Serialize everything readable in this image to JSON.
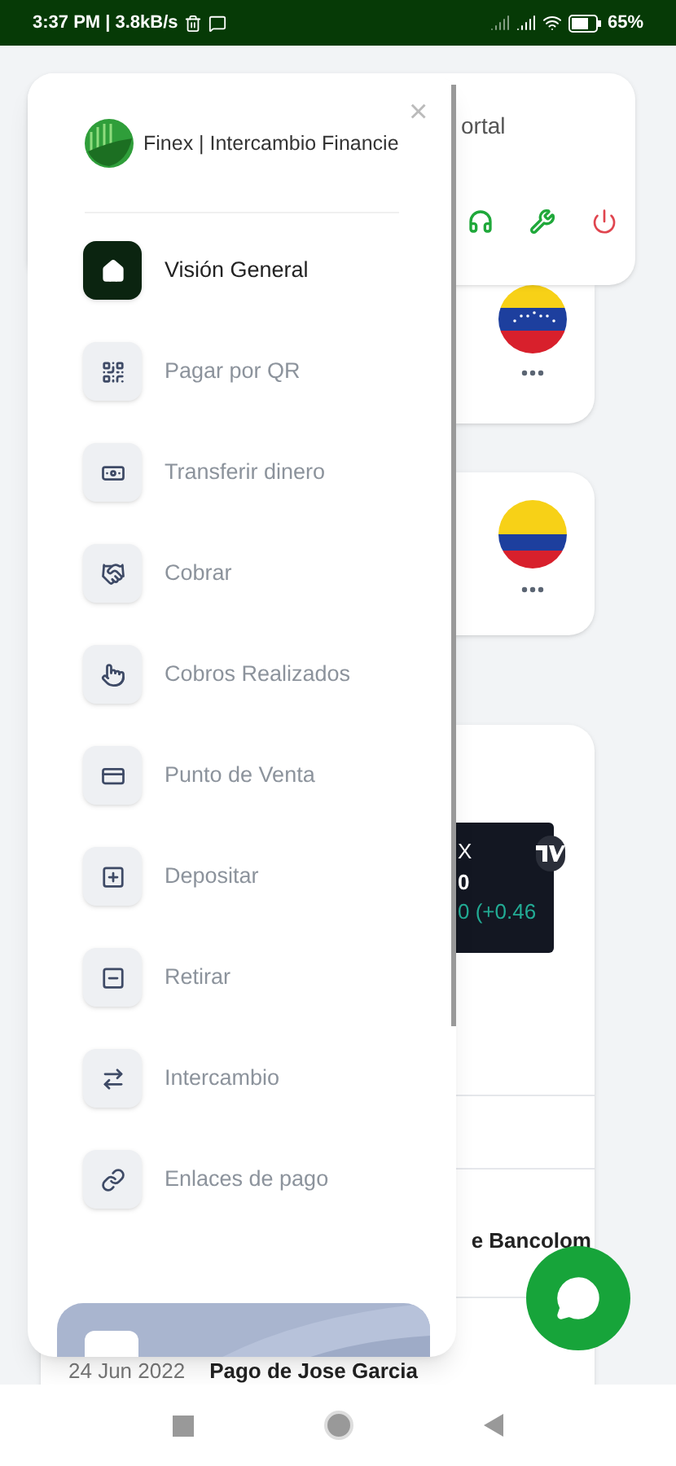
{
  "status_bar": {
    "time": "3:37 PM | 3.8kB/s",
    "battery": "65%"
  },
  "drawer": {
    "brand": "Finex | Intercambio Financie",
    "close": "×",
    "items": [
      {
        "label": "Visión General",
        "selected": true
      },
      {
        "label": "Pagar por QR",
        "selected": false
      },
      {
        "label": "Transferir dinero",
        "selected": false
      },
      {
        "label": "Cobrar",
        "selected": false
      },
      {
        "label": "Cobros Realizados",
        "selected": false
      },
      {
        "label": "Punto de Venta",
        "selected": false
      },
      {
        "label": "Depositar",
        "selected": false
      },
      {
        "label": "Retirar",
        "selected": false
      },
      {
        "label": "Intercambio",
        "selected": false
      },
      {
        "label": "Enlaces de pago",
        "selected": false
      }
    ]
  },
  "page": {
    "header_text": "ortal",
    "ticker": {
      "symbol": "X",
      "price": "0",
      "change": "0 (+0.46"
    },
    "list_text": "e Bancolom",
    "row": {
      "date": "24 Jun 2022",
      "title": "Pago de Jose Garcia"
    }
  }
}
